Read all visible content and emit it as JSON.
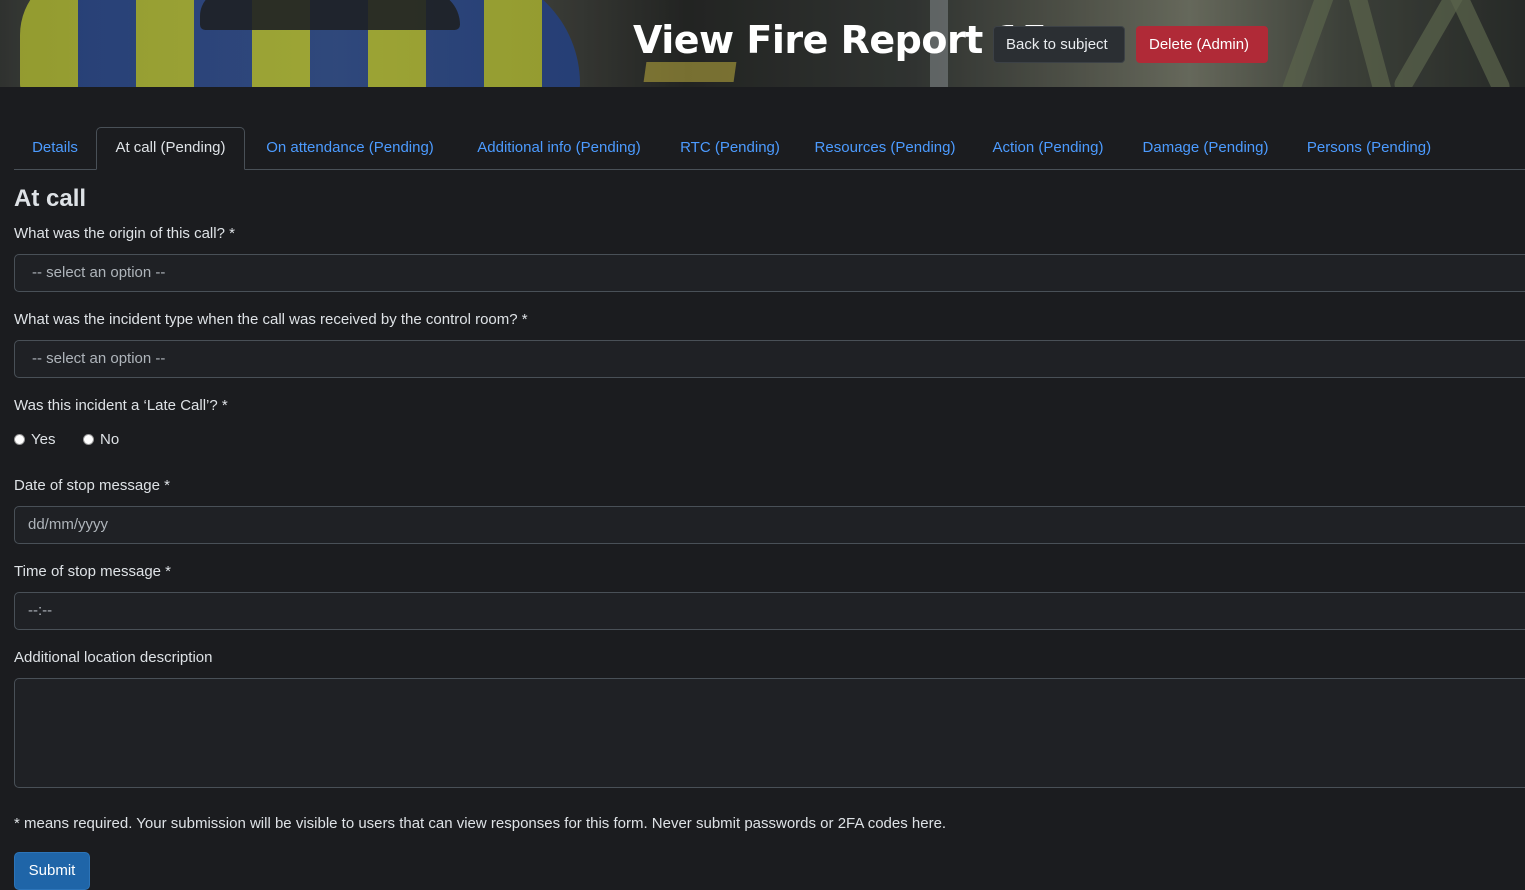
{
  "header": {
    "title": "View Fire Report 15",
    "back_label": "Back to subject",
    "delete_label": "Delete (Admin)",
    "delete_color": "#b02a37"
  },
  "tabs": [
    {
      "label": "Details",
      "active": false
    },
    {
      "label": "At call (Pending)",
      "active": true
    },
    {
      "label": "On attendance (Pending)",
      "active": false
    },
    {
      "label": "Additional info (Pending)",
      "active": false
    },
    {
      "label": "RTC (Pending)",
      "active": false
    },
    {
      "label": "Resources (Pending)",
      "active": false
    },
    {
      "label": "Action (Pending)",
      "active": false
    },
    {
      "label": "Damage (Pending)",
      "active": false
    },
    {
      "label": "Persons (Pending)",
      "active": false
    }
  ],
  "form": {
    "section_title": "At call",
    "origin": {
      "label": "What was the origin of this call? *",
      "value": "-- select an option --"
    },
    "incident_type": {
      "label": "What was the incident type when the call was received by the control room? *",
      "value": "-- select an option --"
    },
    "late_call": {
      "label": "Was this incident a ‘Late Call’? *",
      "options": [
        "Yes",
        "No"
      ]
    },
    "stop_date": {
      "label": "Date of stop message *",
      "placeholder": "dd/mm/yyyy"
    },
    "stop_time": {
      "label": "Time of stop message *",
      "placeholder": "--:--"
    },
    "location": {
      "label": "Additional location description",
      "value": ""
    },
    "note": "* means required. Your submission will be visible to users that can view responses for this form. Never submit passwords or 2FA codes here.",
    "submit_label": "Submit"
  },
  "colors": {
    "background": "#1b1c1f",
    "link": "#4c9bff",
    "submit": "#1f65a8"
  }
}
